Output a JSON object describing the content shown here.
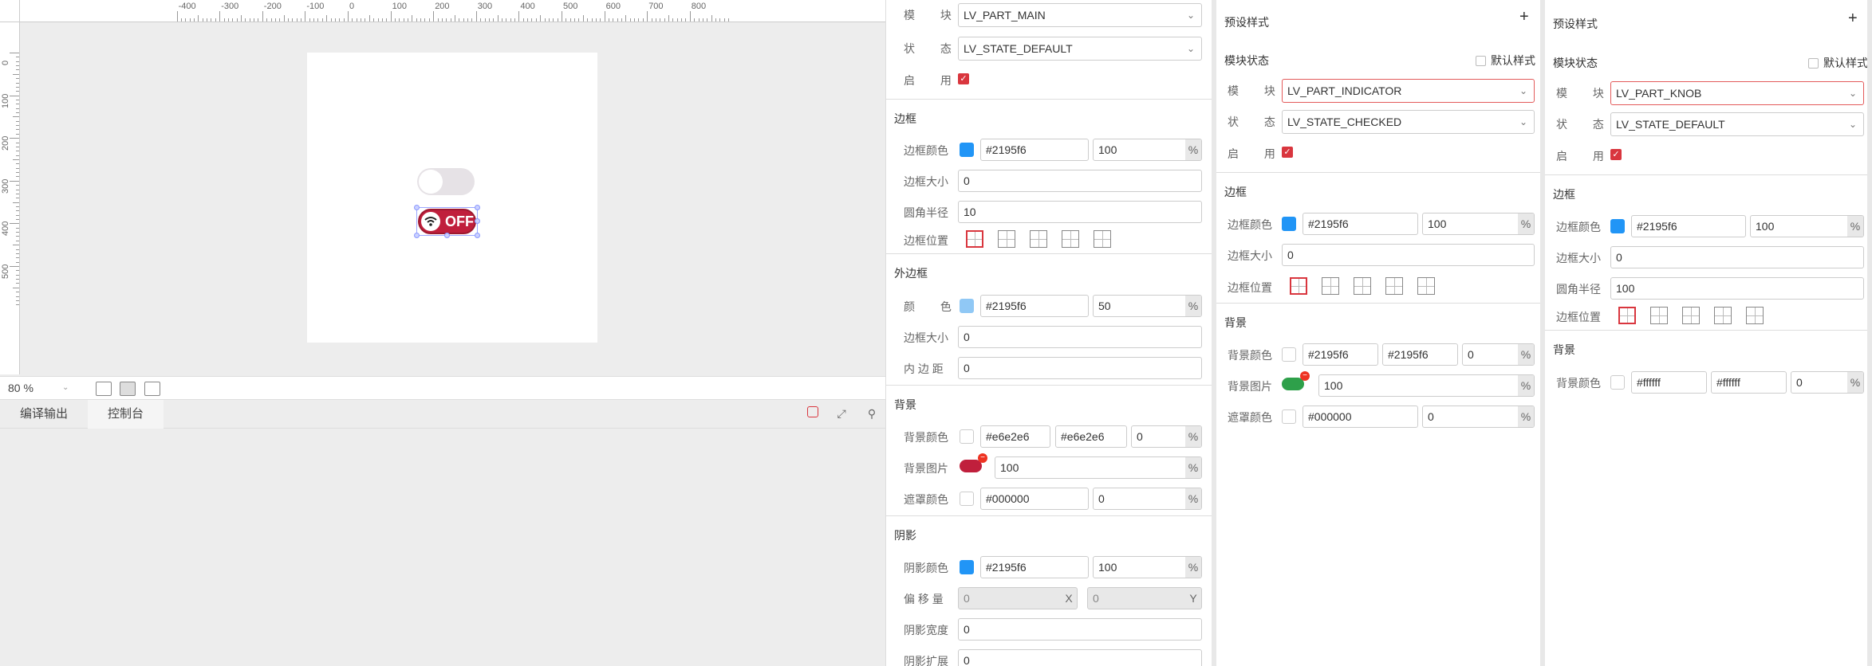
{
  "canvas": {
    "ruler_top": [
      "-400",
      "-300",
      "-200",
      "-100",
      "0",
      "100",
      "200",
      "300",
      "400",
      "500",
      "600",
      "700",
      "800"
    ],
    "ruler_left": [
      "0",
      "100",
      "200",
      "300",
      "400",
      "500"
    ],
    "switch_text": "OFF",
    "zoom": "80 %"
  },
  "output": {
    "tabs": [
      {
        "label": "编译输出"
      },
      {
        "label": "控制台"
      }
    ]
  },
  "panel_main": {
    "module_label": "模 块",
    "module_value": "LV_PART_MAIN",
    "state_label": "状 态",
    "state_value": "LV_STATE_DEFAULT",
    "enable_label": "启 用",
    "border": {
      "title": "边框",
      "color_label": "边框颜色",
      "color": "#2195f6",
      "opa": "100",
      "size_label": "边框大小",
      "size": "0",
      "radius_label": "圆角半径",
      "radius": "10",
      "pos_label": "边框位置"
    },
    "outline": {
      "title": "外边框",
      "color_label": "颜 色",
      "color": "#2195f6",
      "opa": "50",
      "size_label": "边框大小",
      "size": "0",
      "pad_label": "内 边 距",
      "pad": "0"
    },
    "bg": {
      "title": "背景",
      "color_label": "背景颜色",
      "color1": "#e6e2e6",
      "color2": "#e6e2e6",
      "opa": "0",
      "img_label": "背景图片",
      "img_opa": "100",
      "mask_label": "遮罩颜色",
      "mask_color": "#000000",
      "mask_opa": "0"
    },
    "shadow": {
      "title": "阴影",
      "color_label": "阴影颜色",
      "color": "#2195f6",
      "opa": "100",
      "offset_label": "偏 移 量",
      "offset_x": "0",
      "offset_y": "0",
      "x_suffix": "X",
      "y_suffix": "Y",
      "width_label": "阴影宽度",
      "width": "0",
      "spread_label": "阴影扩展",
      "spread": "0"
    }
  },
  "panel_ind": {
    "title": "预设样式",
    "mod_state": "模块状态",
    "default_style": "默认样式",
    "module_label": "模 块",
    "module_value": "LV_PART_INDICATOR",
    "state_label": "状 态",
    "state_value": "LV_STATE_CHECKED",
    "enable_label": "启 用",
    "border": {
      "title": "边框",
      "color_label": "边框颜色",
      "color": "#2195f6",
      "opa": "100",
      "size_label": "边框大小",
      "size": "0",
      "pos_label": "边框位置"
    },
    "bg": {
      "title": "背景",
      "color_label": "背景颜色",
      "color1": "#2195f6",
      "color2": "#2195f6",
      "opa": "0",
      "img_label": "背景图片",
      "img_opa": "100",
      "mask_label": "遮罩颜色",
      "mask_color": "#000000",
      "mask_opa": "0"
    }
  },
  "panel_knob": {
    "title": "预设样式",
    "mod_state": "模块状态",
    "default_style": "默认样式",
    "module_label": "模 块",
    "module_value": "LV_PART_KNOB",
    "state_label": "状 态",
    "state_value": "LV_STATE_DEFAULT",
    "enable_label": "启 用",
    "border": {
      "title": "边框",
      "color_label": "边框颜色",
      "color": "#2195f6",
      "opa": "100",
      "size_label": "边框大小",
      "size": "0",
      "radius_label": "圆角半径",
      "radius": "100",
      "pos_label": "边框位置"
    },
    "bg": {
      "title": "背景",
      "color_label": "背景颜色",
      "color1": "#ffffff",
      "color2": "#ffffff",
      "opa": "0"
    }
  },
  "common": {
    "percent": "%",
    "check": "✓",
    "plus": "+",
    "chev": "⌄",
    "minus": "−"
  },
  "colors": {
    "accent_red": "#d9363e",
    "blue": "#2195f6",
    "switch_red": "#c01f3c",
    "bg_grey": "#e6e2e6"
  }
}
